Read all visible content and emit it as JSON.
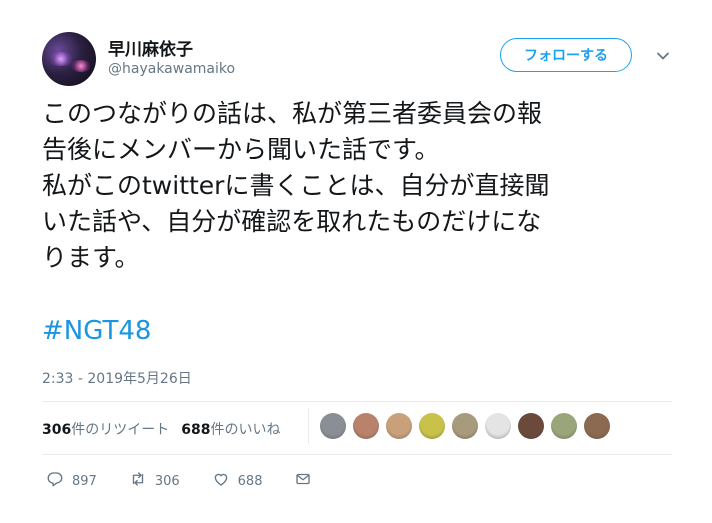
{
  "user": {
    "display_name": "早川麻依子",
    "handle": "@hayakawamaiko",
    "follow_label": "フォローする"
  },
  "tweet": {
    "text": "このつながりの話は、私が第三者委員会の報\n告後にメンバーから聞いた話です。\n私がこのtwitterに書くことは、自分が直接聞\nいた話や、自分が確認を取れたものだけにな\nります。",
    "hashtag": "#NGT48",
    "timestamp": "2:33 - 2019年5月26日"
  },
  "stats": {
    "retweet_count": "306",
    "retweet_label": "件のリツイート",
    "like_count": "688",
    "like_label": "件のいいね"
  },
  "likers": [
    {
      "icon": "liker-avatar",
      "color": "#8a8f96"
    },
    {
      "icon": "liker-avatar",
      "color": "#b9826a"
    },
    {
      "icon": "liker-avatar",
      "color": "#c8a07a"
    },
    {
      "icon": "liker-avatar",
      "color": "#c9c24a"
    },
    {
      "icon": "liker-avatar",
      "color": "#a89a7c"
    },
    {
      "icon": "liker-avatar",
      "color": "#e4e4e4"
    },
    {
      "icon": "liker-avatar",
      "color": "#6b4a3c"
    },
    {
      "icon": "liker-avatar",
      "color": "#9aa67a"
    },
    {
      "icon": "liker-avatar",
      "color": "#8c6a52"
    }
  ],
  "actions": {
    "reply_count": "897",
    "retweet_count": "306",
    "like_count": "688"
  },
  "colors": {
    "accent": "#1da1f2",
    "hashtag": "#1b95e0",
    "muted": "#657786",
    "text": "#14171a",
    "divider": "#e6ecf0"
  }
}
